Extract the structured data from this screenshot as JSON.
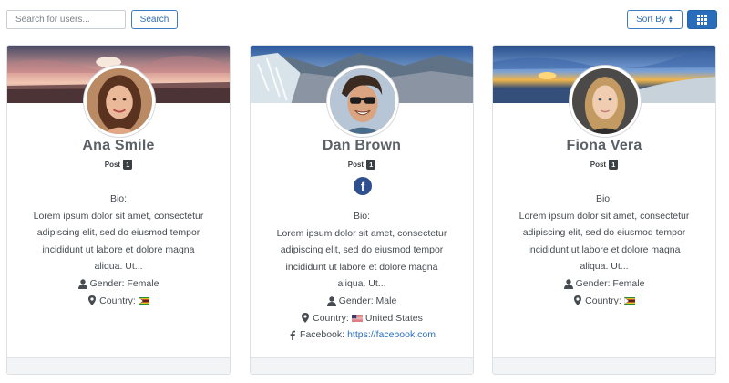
{
  "toolbar": {
    "search_placeholder": "Search for users...",
    "search_label": "Search",
    "sort_label": "Sort By"
  },
  "users": [
    {
      "name": "Ana Smile",
      "post_label": "Post",
      "post_count": "1",
      "bio_label": "Bio:",
      "bio": "Lorem ipsum dolor sit amet, consectetur adipiscing elit, sed do eiusmod tempor incididunt ut labore et dolore magna aliqua. Ut...",
      "gender": "Gender: Female",
      "country": "Country:",
      "country_flag": "flag-zimbabwe"
    },
    {
      "name": "Dan Brown",
      "post_label": "Post",
      "post_count": "1",
      "bio_label": "Bio:",
      "bio": "Lorem ipsum dolor sit amet, consectetur adipiscing elit, sed do eiusmod tempor incididunt ut labore et dolore magna aliqua. Ut...",
      "gender": "Gender: Male",
      "country": "Country:",
      "country_name": "United States",
      "country_flag": "flag-united-states",
      "facebook_label": "Facebook:",
      "facebook_url": "https://facebook.com"
    },
    {
      "name": "Fiona Vera",
      "post_label": "Post",
      "post_count": "1",
      "bio_label": "Bio:",
      "bio": "Lorem ipsum dolor sit amet, consectetur adipiscing elit, sed do eiusmod tempor incididunt ut labore et dolore magna aliqua. Ut...",
      "gender": "Gender: Female",
      "country": "Country:",
      "country_flag": "flag-zimbabwe"
    }
  ],
  "colors": {
    "accent": "#2a6ebb",
    "facebook": "#2f4f8f",
    "text": "#464b51",
    "name": "#5b6066"
  },
  "icons": [
    "search-icon",
    "sort-icon",
    "grid-view-icon",
    "user-icon",
    "map-marker-icon",
    "facebook-icon"
  ]
}
